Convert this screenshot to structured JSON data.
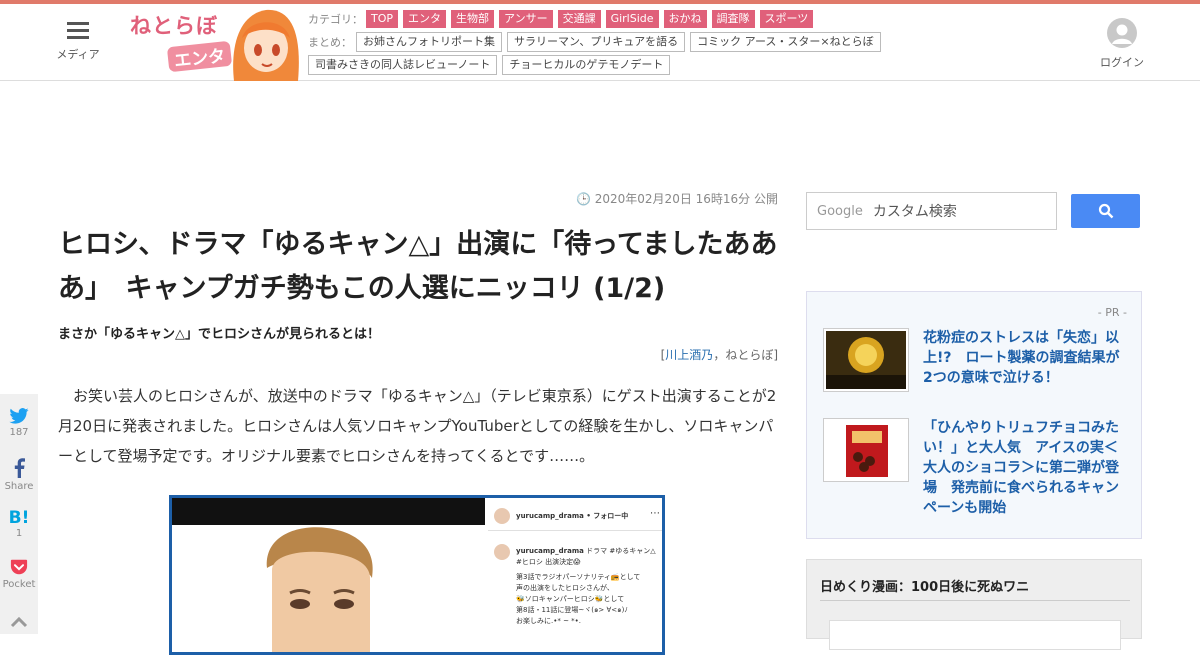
{
  "header": {
    "menu_label": "メディア",
    "logo_text": "ねとらぼ",
    "logo_sub": "エンタ",
    "category_label": "カテゴリ：",
    "categories": [
      "TOP",
      "エンタ",
      "生物部",
      "アンサー",
      "交通課",
      "GirlSide",
      "おかね",
      "調査隊",
      "スポーツ"
    ],
    "matome_label": "まとめ：",
    "matome": [
      "お姉さんフォトリポート集",
      "サラリーマン、プリキュアを語る",
      "コミック アース・スター×ねとらぼ",
      "司書みさきの同人誌レビューノート",
      "チョーヒカルのゲテモノデート"
    ],
    "login_label": "ログイン"
  },
  "article": {
    "date": "2020年02月20日 16時16分 公開",
    "title": "ヒロシ、ドラマ「ゆるキャン△」出演に「待ってましたあああ」　キャンプガチ勢もこの人選にニッコリ (1/2)",
    "subtitle": "まさか「ゆるキャン△」でヒロシさんが見られるとは！",
    "byline_open": "[",
    "author": "川上酒乃",
    "byline_rest": "，ねとらぼ]",
    "body": "お笑い芸人のヒロシさんが、放送中のドラマ「ゆるキャン△」（テレビ東京系）にゲスト出演することが2月20日に発表されました。ヒロシさんは人気ソロキャンプYouTuberとしての経験を生かし、ソロキャンパーとして登場予定です。オリジナル要素でヒロシさんを持ってくるとです……。",
    "insta": {
      "account": "yurucamp_drama",
      "follow": "• フォロー中",
      "caption_account": "yurucamp_drama",
      "caption": "ドラマ #ゆるキャン△ #ヒロシ 出演決定😱",
      "lines": [
        "第3話でラジオパーソナリティ📻として",
        "声の出演をしたヒロシさんが、",
        "🐝ソロキャンパーヒロシ🐝として",
        "第8話・11話に登場~ヾ(๑> ∀<๑)ﾉ",
        "お楽しみに.•* ~ *•."
      ]
    }
  },
  "share": {
    "twitter_count": "187",
    "facebook_label": "Share",
    "hatena_count": "1",
    "pocket_label": "Pocket"
  },
  "sidebar": {
    "search_placeholder": "カスタム検索",
    "google_label": "Google",
    "pr_label": "- PR -",
    "pr_items": [
      "花粉症のストレスは「失恋」以上!?　ロート製薬の調査結果が2つの意味で泣ける！",
      "「ひんやりトリュフチョコみたい！」と大人気　アイスの実＜大人のショコラ＞に第二弾が登場　発売前に食べられるキャンペーンも開始"
    ],
    "manga_title": "日めくり漫画：100日後に死ぬワニ"
  },
  "colors": {
    "accent": "#e0607a",
    "link": "#1d5fa8",
    "search_button": "#4a8af4"
  }
}
